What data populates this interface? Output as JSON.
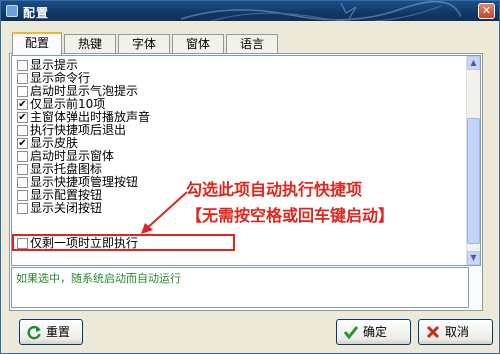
{
  "window": {
    "title": "配置",
    "close_label": "✕"
  },
  "tabs": [
    {
      "label": "配置",
      "active": true
    },
    {
      "label": "热键",
      "active": false
    },
    {
      "label": "字体",
      "active": false
    },
    {
      "label": "窗体",
      "active": false
    },
    {
      "label": "语言",
      "active": false
    }
  ],
  "options": [
    {
      "label": "显示提示",
      "checked": false
    },
    {
      "label": "显示命令行",
      "checked": false
    },
    {
      "label": "启动时显示气泡提示",
      "checked": false
    },
    {
      "label": "仅显示前10项",
      "checked": true
    },
    {
      "label": "主窗体弹出时播放声音",
      "checked": true
    },
    {
      "label": "执行快捷项后退出",
      "checked": false
    },
    {
      "label": "显示皮肤",
      "checked": true
    },
    {
      "label": "启动时显示窗体",
      "checked": false
    },
    {
      "label": "显示托盘图标",
      "checked": false
    },
    {
      "label": "显示快捷项管理按钮",
      "checked": false
    },
    {
      "label": "显示配置按钮",
      "checked": false
    },
    {
      "label": "显示关闭按钮",
      "checked": false
    },
    {
      "label": "仅剩一项时立即执行",
      "checked": false
    }
  ],
  "annotation": {
    "line1": "勾选此项自动执行快捷项",
    "line2": "【无需按空格或回车键启动】"
  },
  "description": "如果选中，随系统启动而自动运行",
  "buttons": {
    "reset": "重置",
    "ok": "确定",
    "cancel": "取消"
  },
  "colors": {
    "annotation": "#e0251c",
    "description_text": "#278a2d",
    "titlebar": "#1d4f86"
  },
  "icons": {
    "title": "app-icon",
    "reset": "refresh-icon",
    "ok": "checkmark-icon",
    "cancel": "x-icon"
  }
}
